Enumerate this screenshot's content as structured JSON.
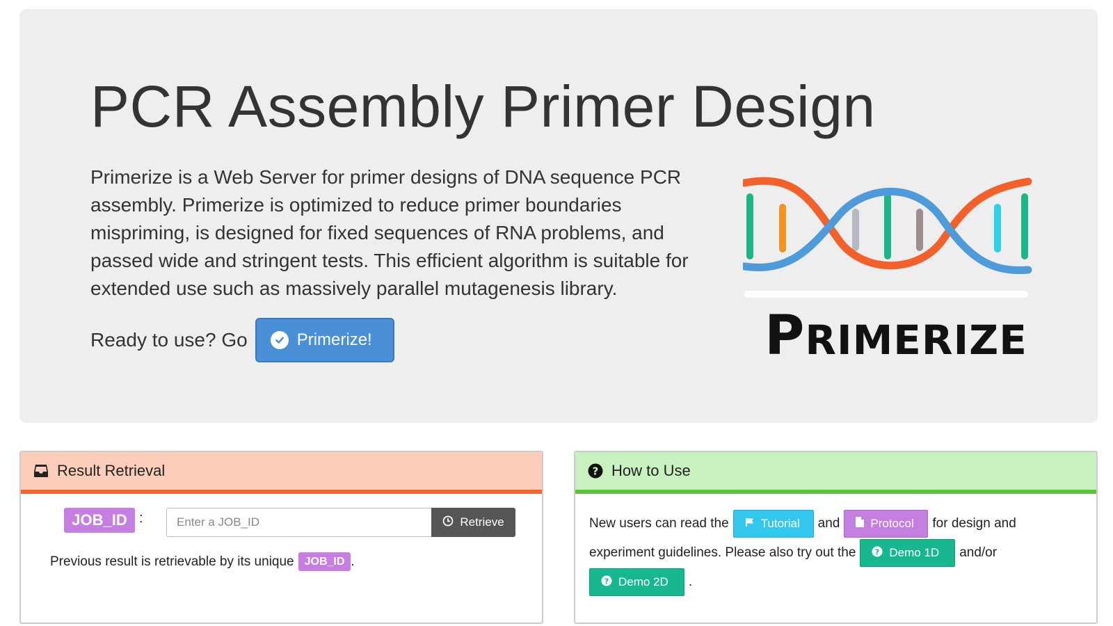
{
  "hero": {
    "title": "PCR Assembly Primer Design",
    "intro": "Primerize is a Web Server for primer designs of DNA sequence PCR assembly. Primerize is optimized to reduce primer boundaries mispriming, is designed for fixed sequences of RNA problems, and passed wide and stringent tests. This efficient algorithm is suitable for extended use such as massively parallel mutagenesis library.",
    "ready_text": "Ready to use? Go",
    "primerize_button": "Primerize!",
    "logo_text_first": "P",
    "logo_text_rest": "RIMERIZE"
  },
  "result_panel": {
    "heading": "Result Retrieval",
    "jobid_label": "JOB_ID",
    "colon": ":",
    "input_placeholder": "Enter a JOB_ID",
    "retrieve_button": "Retrieve",
    "info_text": "Previous result is retrievable by its unique",
    "info_badge": "JOB_ID",
    "info_end": "."
  },
  "howto_panel": {
    "heading": "How to Use",
    "text1": "New users can read the",
    "tutorial_button": "Tutorial",
    "text_and": "and",
    "protocol_button": "Protocol",
    "text2": "for design and",
    "text3": "experiment guidelines. Please also try out the",
    "demo1d_button": "Demo 1D",
    "text_andor": "and/or",
    "demo2d_button": "Demo 2D",
    "text_end": "."
  },
  "colors": {
    "jumbotron_bg": "#eeeeee",
    "primary_button": "#4a90d9",
    "result_heading_bg": "#fccdbb",
    "result_heading_border": "#f06630",
    "howto_heading_bg": "#c9f0c0",
    "howto_heading_border": "#5bc43a",
    "jobid_badge": "#c47fe0",
    "tutorial_button": "#33c7ee",
    "demo_button": "#17b890"
  },
  "icons": {
    "primerize_button": "check-circle-icon",
    "result_heading": "inbox-icon",
    "howto_heading": "question-circle-icon",
    "retrieve_button": "clock-icon",
    "tutorial_button": "flag-icon",
    "protocol_button": "file-icon",
    "demo_buttons": "question-circle-icon"
  }
}
